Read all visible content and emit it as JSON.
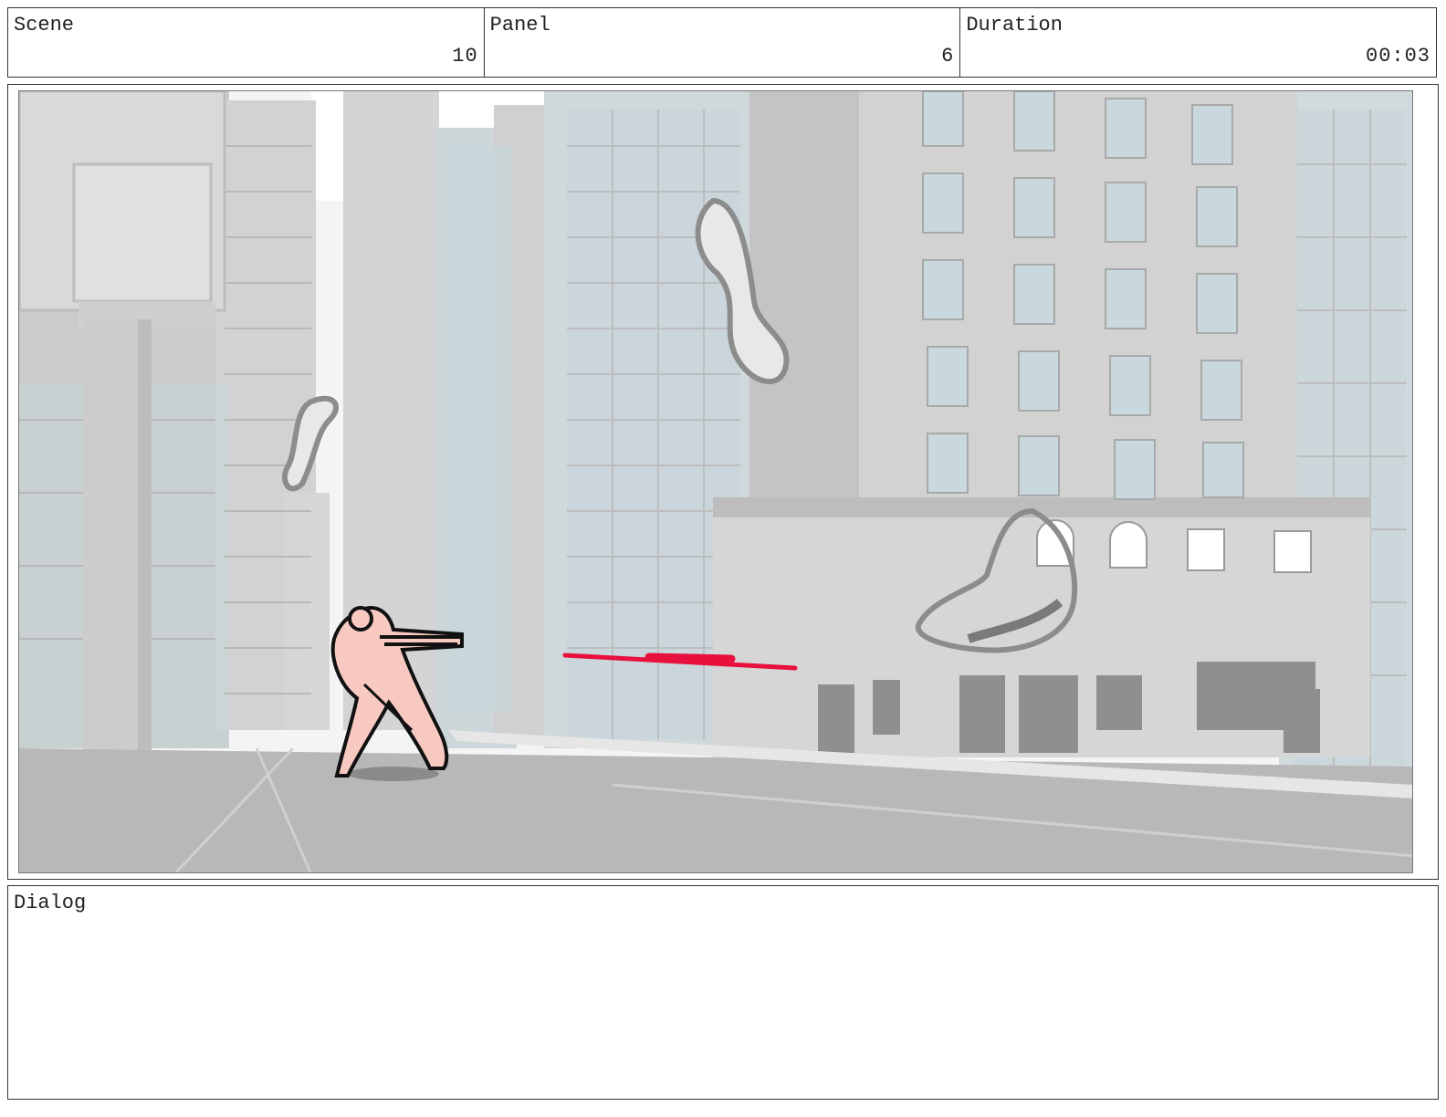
{
  "header": {
    "scene_label": "Scene",
    "scene_value": "10",
    "panel_label": "Panel",
    "panel_value": "6",
    "duration_label": "Duration",
    "duration_value": "00:03"
  },
  "dialog": {
    "label": "Dialog",
    "text": ""
  },
  "colors": {
    "border": "#333333",
    "sky": "#ffffff",
    "building": "#cfcfcf",
    "window_glass": "#c9dadf",
    "figure_fill": "#f7c9c1",
    "laser": "#e8103c",
    "sketch_gray": "#8c8c8c"
  }
}
